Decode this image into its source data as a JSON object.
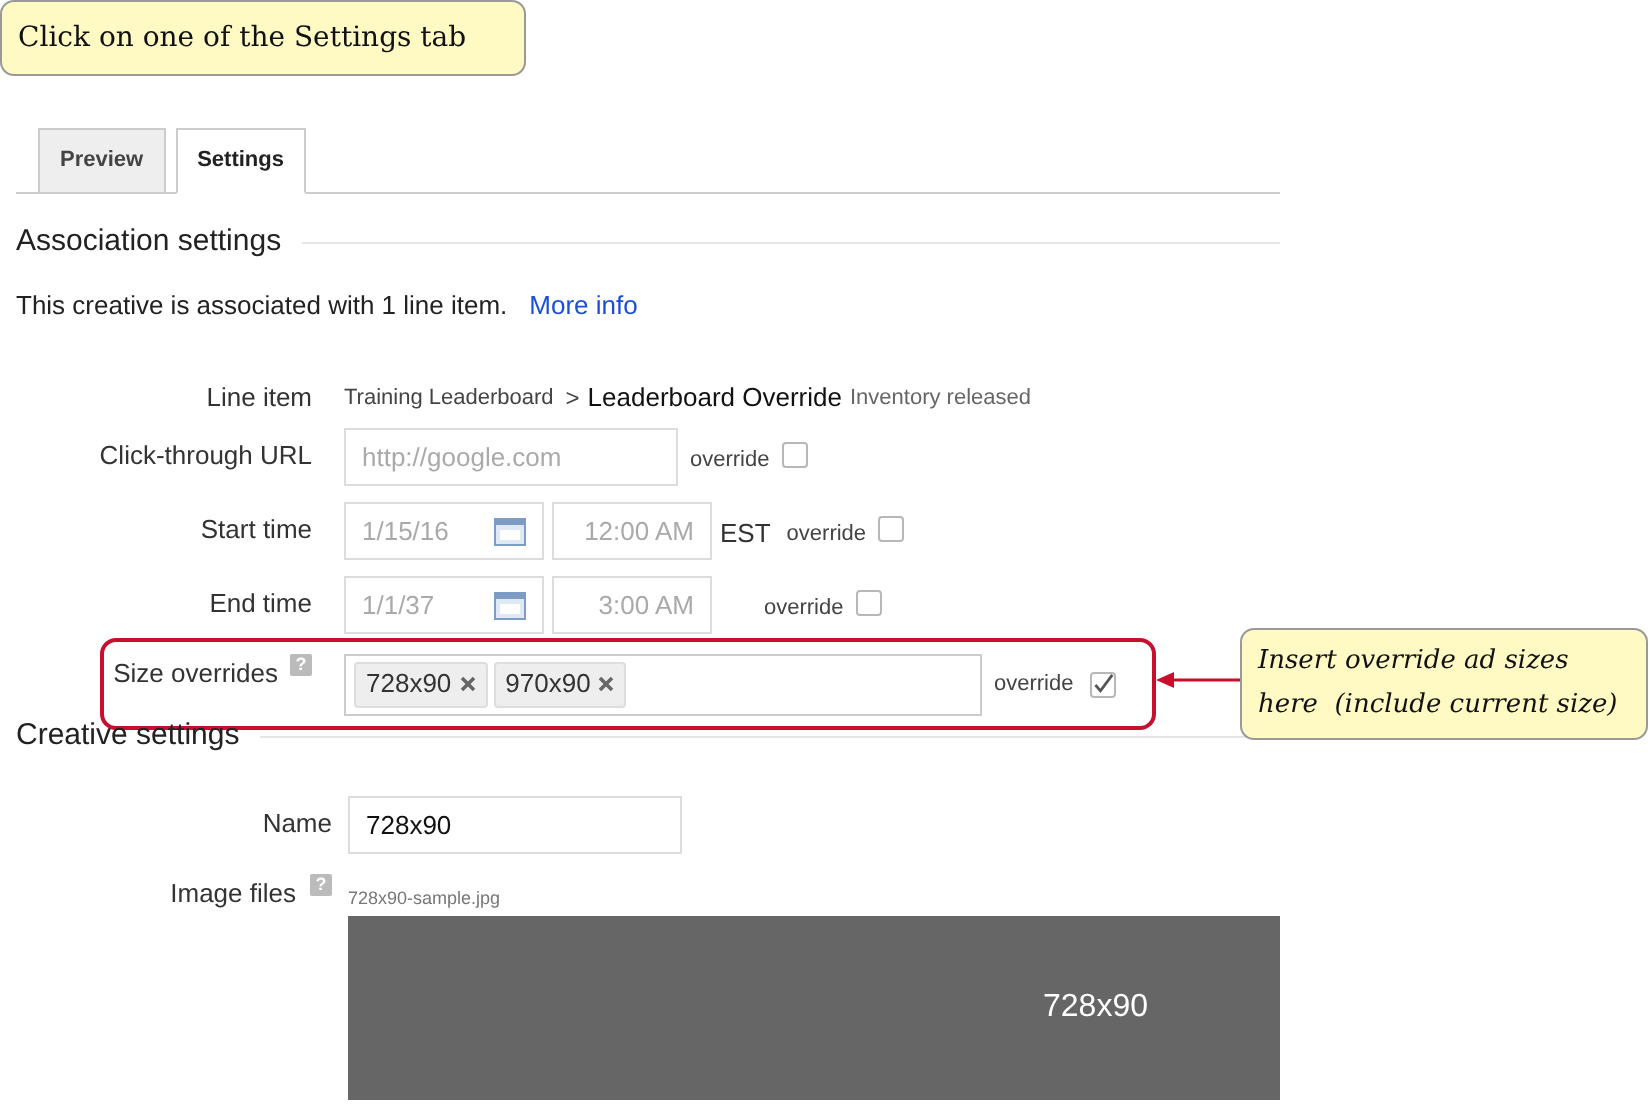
{
  "instruction_callout": {
    "text": "Click on one of the Settings tab"
  },
  "tabs": [
    {
      "label": "Preview",
      "selected": false
    },
    {
      "label": "Settings",
      "selected": true
    }
  ],
  "association": {
    "title": "Association settings",
    "text": "This creative is associated with 1 line item.",
    "link": "More info"
  },
  "rows": [
    {
      "kind": "line_item",
      "label": "Line item",
      "parent": "Training Leaderboard",
      "separator": ">",
      "name": "Leaderboard Override",
      "status": "Inventory released"
    },
    {
      "kind": "url",
      "label": "Click-through URL",
      "placeholder": "http://google.com",
      "override": "override",
      "checked": false
    },
    {
      "kind": "datetime",
      "label": "Start time",
      "date": "1/15/16",
      "time": "12:00 AM",
      "timezone": "EST",
      "override": "override",
      "checked": false
    },
    {
      "kind": "datetime",
      "label": "End time",
      "date": "1/1/37",
      "time": "3:00 AM",
      "override": "override",
      "checked": false
    },
    {
      "kind": "sizes",
      "label": "Size overrides",
      "help": "?",
      "tags": [
        "728x90",
        "970x90"
      ],
      "override": "override",
      "checked": true,
      "highlighted": true
    }
  ],
  "annotation_callout": {
    "lines": [
      "Insert override ad sizes",
      "here  (include current size)"
    ]
  },
  "creative": {
    "title": "Creative settings",
    "name_label": "Name",
    "name_value": "728x90",
    "files_label": "Image files",
    "help": "?",
    "file_name": "728x90-sample.jpg",
    "preview_text": "728x90"
  }
}
